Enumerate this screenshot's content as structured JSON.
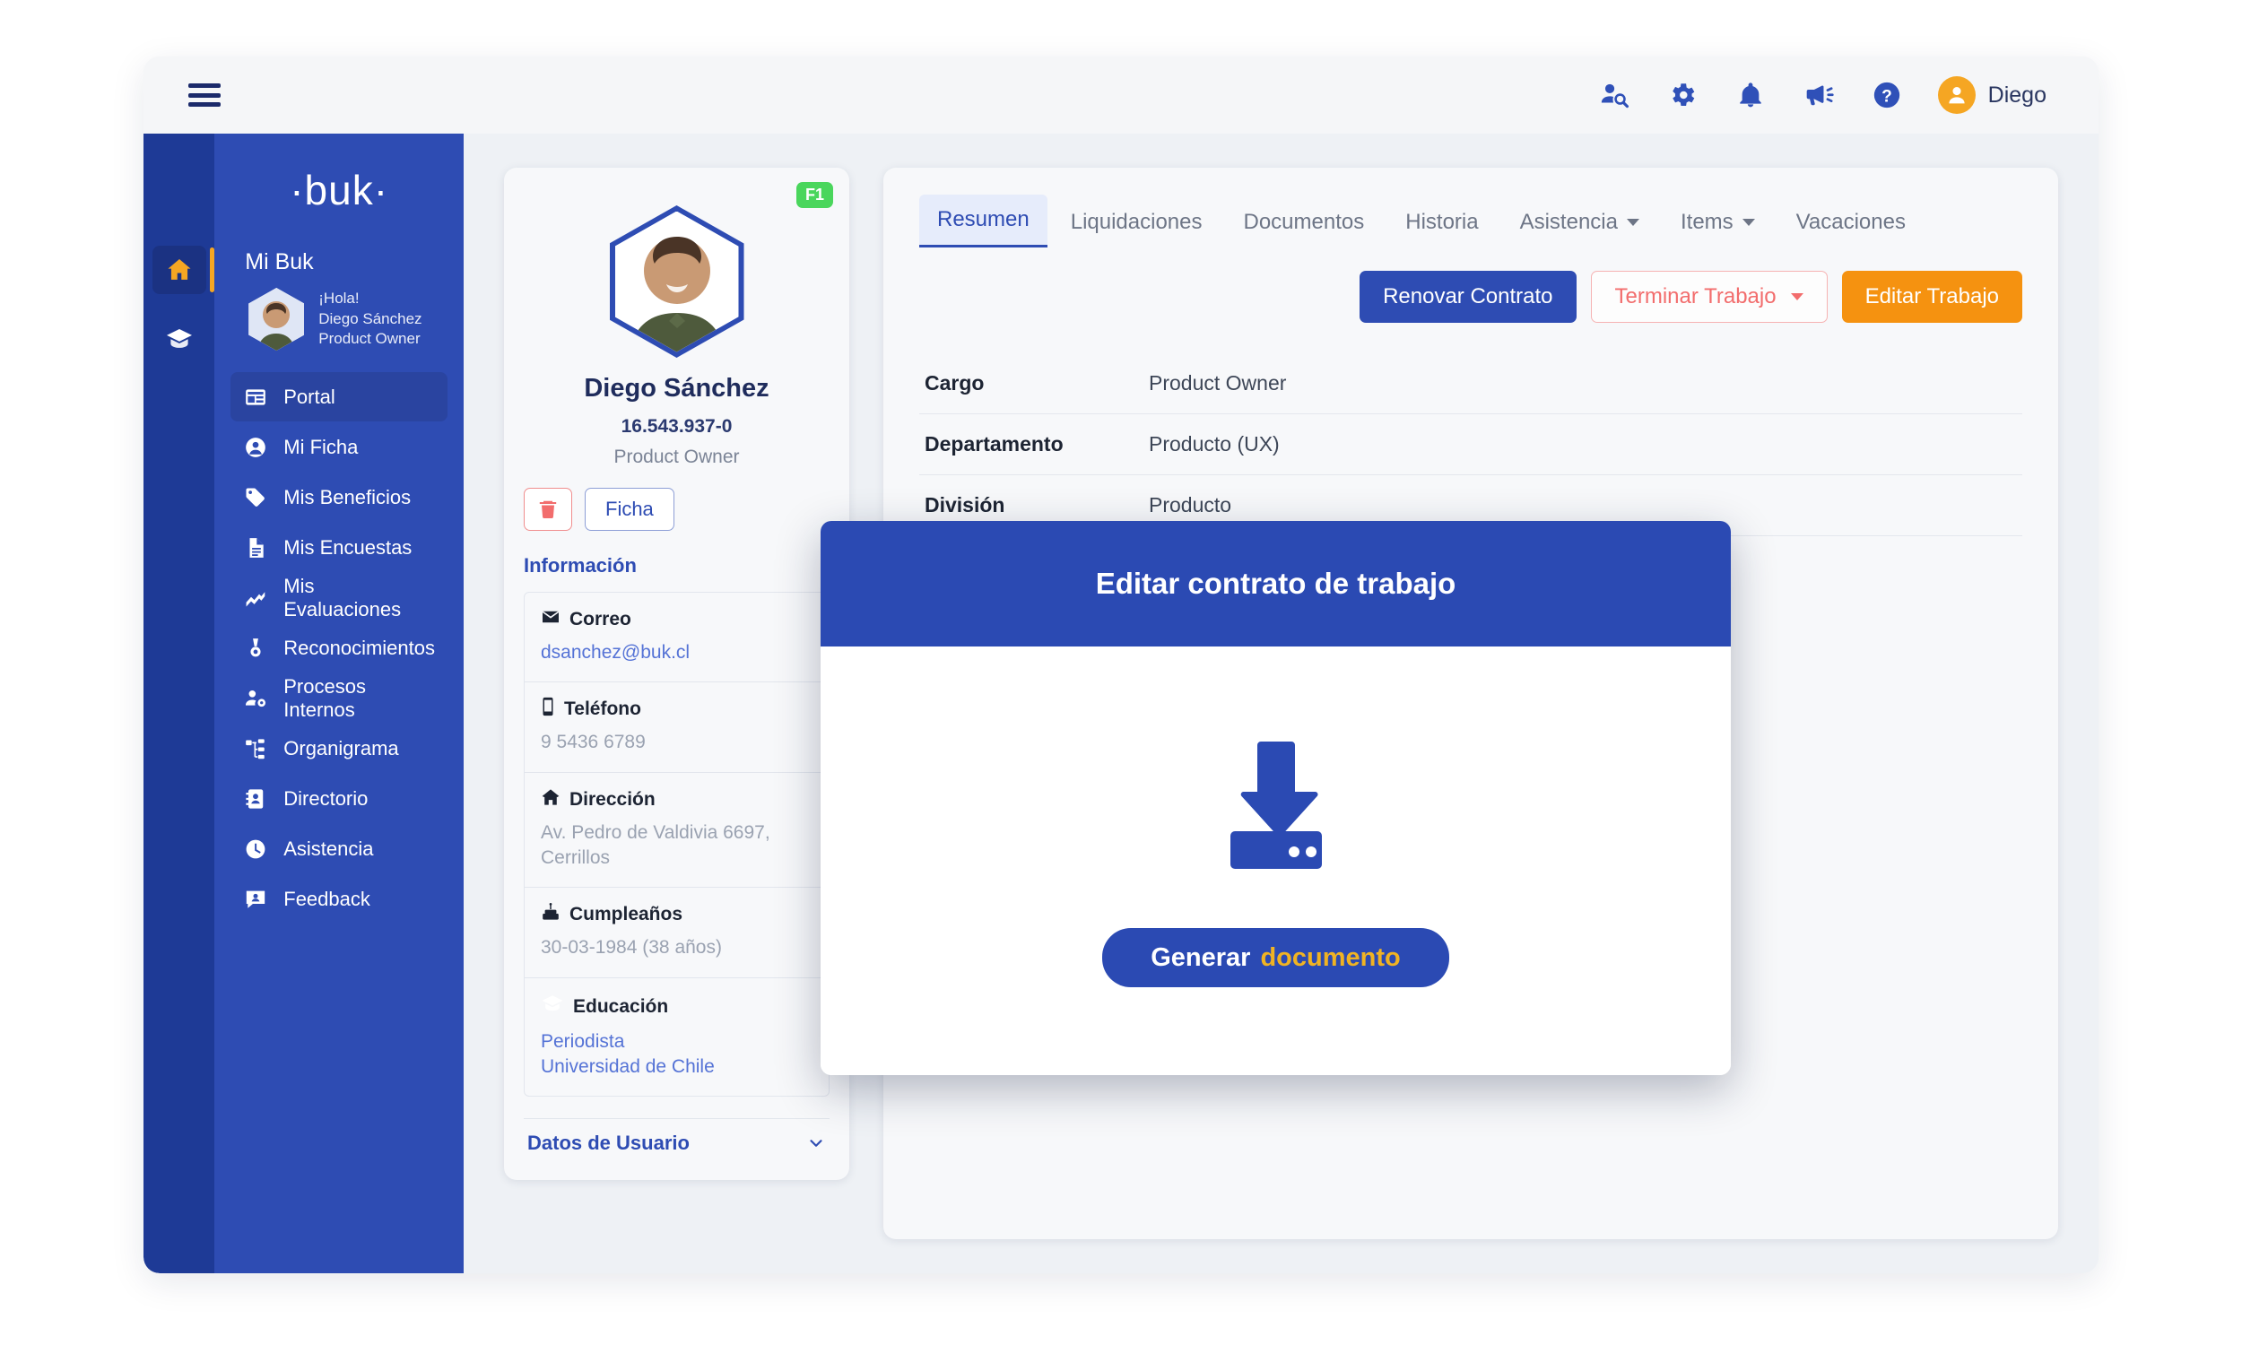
{
  "topbar": {
    "menu_icon": "hamburger-icon",
    "icons": [
      {
        "name": "user-search-icon",
        "label": "Buscar persona"
      },
      {
        "name": "gear-icon",
        "label": "Configuración"
      },
      {
        "name": "bell-icon",
        "label": "Notificaciones"
      },
      {
        "name": "megaphone-icon",
        "label": "Novedades"
      },
      {
        "name": "help-icon",
        "label": "Ayuda"
      }
    ],
    "user_name": "Diego"
  },
  "sidebar": {
    "brand": "·buk·",
    "title": "Mi Buk",
    "rail": [
      {
        "name": "home-icon",
        "active": true
      },
      {
        "name": "graduation-cap-icon",
        "active": false
      }
    ],
    "user": {
      "greeting": "¡Hola!",
      "name": "Diego Sánchez",
      "role": "Product Owner"
    },
    "items": [
      {
        "label": "Portal",
        "icon": "portal-icon",
        "active": true
      },
      {
        "label": "Mi Ficha",
        "icon": "person-circle-icon",
        "active": false
      },
      {
        "label": "Mis Beneficios",
        "icon": "tags-icon",
        "active": false
      },
      {
        "label": "Mis Encuestas",
        "icon": "document-icon",
        "active": false
      },
      {
        "label": "Mis Evaluaciones",
        "icon": "trend-line-icon",
        "active": false
      },
      {
        "label": "Reconocimientos",
        "icon": "medal-icon",
        "active": false
      },
      {
        "label": "Procesos Internos",
        "icon": "people-gear-icon",
        "active": false
      },
      {
        "label": "Organigrama",
        "icon": "org-chart-icon",
        "active": false
      },
      {
        "label": "Directorio",
        "icon": "address-book-icon",
        "active": false
      },
      {
        "label": "Asistencia",
        "icon": "clock-icon",
        "active": false
      },
      {
        "label": "Feedback",
        "icon": "comment-person-icon",
        "active": false
      }
    ]
  },
  "profile": {
    "badge": "F1",
    "name": "Diego Sánchez",
    "rut": "16.543.937-0",
    "role": "Product Owner",
    "delete_label": "",
    "ficha_label": "Ficha",
    "section_title": "Información",
    "info": [
      {
        "icon": "envelope-icon",
        "label": "Correo",
        "value": "dsanchez@buk.cl",
        "link": true
      },
      {
        "icon": "mobile-icon",
        "label": "Teléfono",
        "value": "9 5436 6789",
        "link": false
      },
      {
        "icon": "home-address-icon",
        "label": "Dirección",
        "value": "Av. Pedro de Valdivia 6697, Cerrillos",
        "link": false
      },
      {
        "icon": "cake-icon",
        "label": "Cumpleaños",
        "value": "30-03-1984 (38 años)",
        "link": false
      },
      {
        "icon": "graduation-cap-icon",
        "label": "Educación",
        "value": "Periodista\nUniversidad de Chile",
        "link": true
      }
    ],
    "datos_usuario": "Datos de Usuario"
  },
  "main": {
    "tabs": [
      {
        "label": "Resumen",
        "active": true,
        "caret": false
      },
      {
        "label": "Liquidaciones",
        "active": false,
        "caret": false
      },
      {
        "label": "Documentos",
        "active": false,
        "caret": false
      },
      {
        "label": "Historia",
        "active": false,
        "caret": false
      },
      {
        "label": "Asistencia",
        "active": false,
        "caret": true
      },
      {
        "label": "Items",
        "active": false,
        "caret": true
      },
      {
        "label": "Vacaciones",
        "active": false,
        "caret": false
      }
    ],
    "actions": {
      "renovar": "Renovar Contrato",
      "terminar": "Terminar Trabajo",
      "editar": "Editar Trabajo"
    },
    "details": [
      {
        "key": "Cargo",
        "value": "Product Owner"
      },
      {
        "key": "Departamento",
        "value": "Producto (UX)"
      },
      {
        "key": "División",
        "value": "Producto"
      }
    ]
  },
  "modal": {
    "title": "Editar contrato de trabajo",
    "icon": "download-icon",
    "button_text": "Generar",
    "button_accent": "documento"
  },
  "colors": {
    "brand_blue": "#2e4cb3",
    "rail_blue": "#1e3a96",
    "accent_orange": "#f59210",
    "badge_green": "#4ad65c",
    "danger_red": "#f26d6d",
    "gold": "#f0b323"
  }
}
